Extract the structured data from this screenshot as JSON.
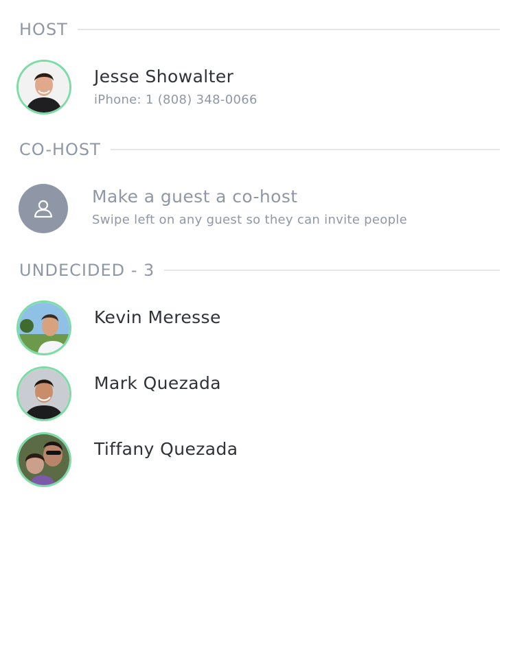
{
  "colors": {
    "accent_ring": "#7bdca6",
    "muted_text": "#8f97a6",
    "primary_text": "#2f3237",
    "divider": "#e3e6ea"
  },
  "host": {
    "section_label": "HOST",
    "name": "Jesse Showalter",
    "phone": "iPhone: 1 (808) 348-0066",
    "avatar_icon": "person-photo-icon"
  },
  "cohost": {
    "section_label": "CO-HOST",
    "title": "Make a guest a co-host",
    "hint": "Swipe left on any guest so they can invite people",
    "avatar_icon": "user-outline-icon"
  },
  "undecided": {
    "section_label": "UNDECIDED - 3",
    "guests": [
      {
        "name": "Kevin Meresse"
      },
      {
        "name": "Mark Quezada"
      },
      {
        "name": "Tiffany Quezada"
      }
    ]
  }
}
